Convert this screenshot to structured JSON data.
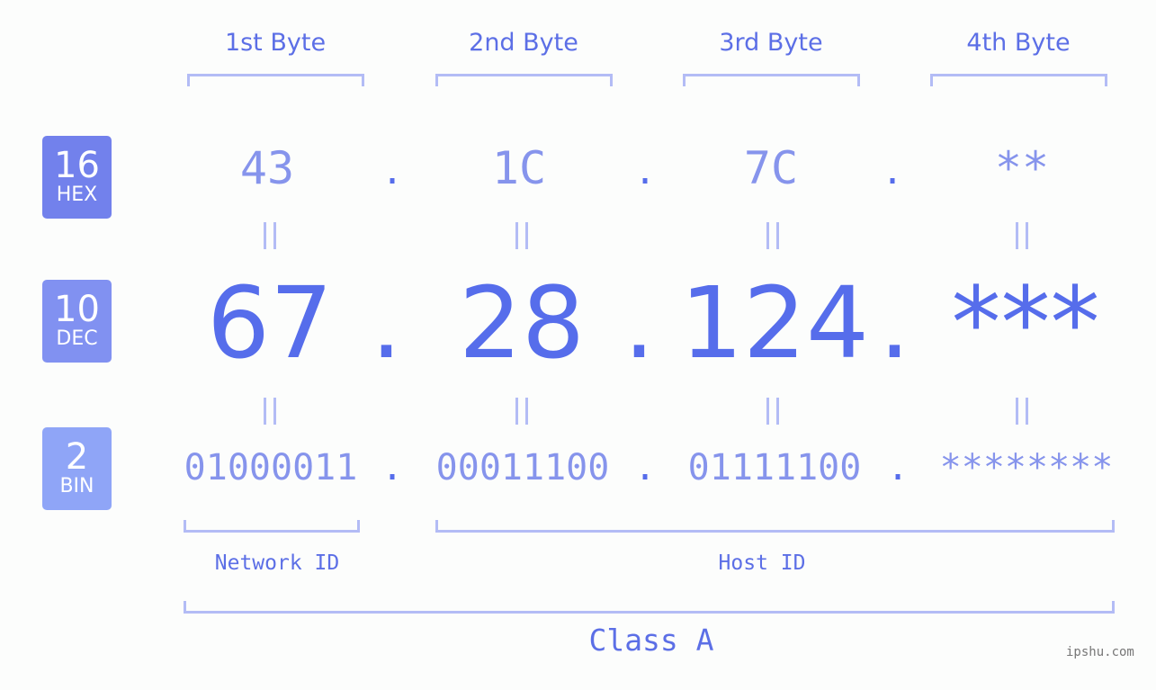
{
  "byte_headers": [
    "1st Byte",
    "2nd Byte",
    "3rd Byte",
    "4th Byte"
  ],
  "badges": [
    {
      "num": "16",
      "label": "HEX",
      "color": "#7281ec"
    },
    {
      "num": "10",
      "label": "DEC",
      "color": "#8191f1"
    },
    {
      "num": "2",
      "label": "BIN",
      "color": "#8fa5f7"
    }
  ],
  "hex": [
    "43",
    "1C",
    "7C",
    "**"
  ],
  "dec": [
    "67",
    "28",
    "124",
    "***"
  ],
  "bin": [
    "01000011",
    "00011100",
    "01111100",
    "********"
  ],
  "separator": ".",
  "network_id_label": "Network ID",
  "host_id_label": "Host ID",
  "class_label": "Class A",
  "watermark": "ipshu.com",
  "colors": {
    "primary": "#566deb",
    "light": "#8694ec",
    "bracket": "#b3bcf5"
  }
}
